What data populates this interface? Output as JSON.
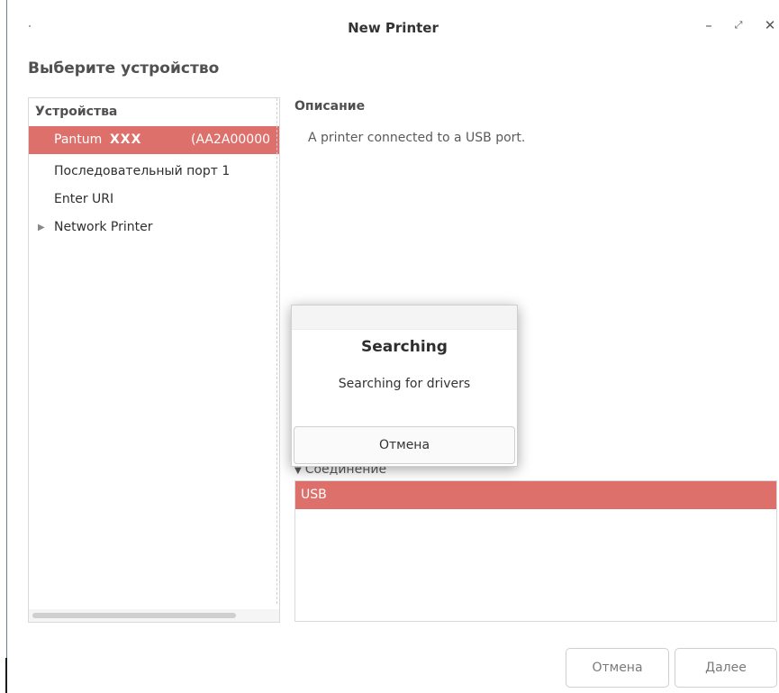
{
  "window": {
    "title": "New Printer",
    "minimize_glyph": "–",
    "maximize_glyph": "⤢",
    "close_glyph": "✕"
  },
  "heading": "Выберите устройство",
  "devices": {
    "header": "Устройства",
    "selected": {
      "name": "Pantum",
      "model": "XXX",
      "id": "(AA2A00000"
    },
    "items": [
      {
        "label": "Последовательный порт 1"
      },
      {
        "label": "Enter URI"
      },
      {
        "label": "Network Printer",
        "expander": "▶"
      }
    ]
  },
  "description": {
    "header": "Описание",
    "text": "A printer connected to a USB port."
  },
  "connection": {
    "header": "Соединение",
    "expander": "▼",
    "selected": "USB"
  },
  "buttons": {
    "cancel": "Отмена",
    "next": "Далее"
  },
  "dialog": {
    "title": "Searching",
    "message": "Searching for drivers",
    "cancel": "Отмена"
  },
  "colors": {
    "selection": "#dd706a"
  }
}
